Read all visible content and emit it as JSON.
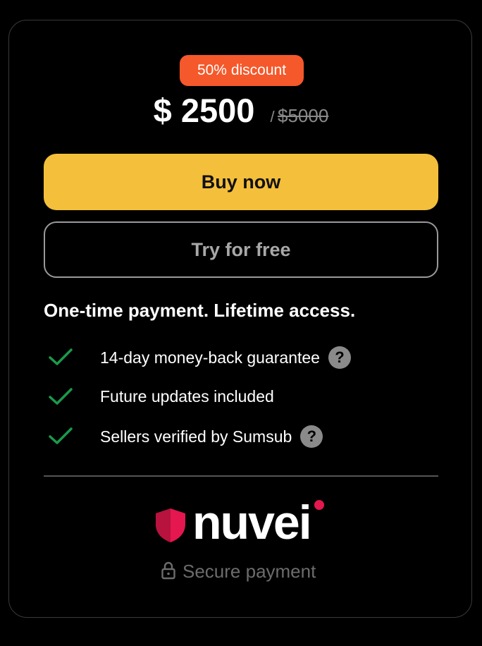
{
  "pricing": {
    "discount_badge": "50% discount",
    "price": "$ 2500",
    "slash": "/",
    "old_price": "$5000"
  },
  "actions": {
    "buy_label": "Buy now",
    "try_label": "Try for free"
  },
  "headline": "One-time payment. Lifetime access.",
  "features": [
    {
      "text": "14-day money-back guarantee",
      "icon": "check-icon",
      "has_help": true
    },
    {
      "text": "Future updates included",
      "icon": "check-icon",
      "has_help": false
    },
    {
      "text": "Sellers verified by Sumsub",
      "icon": "check-icon",
      "has_help": true
    }
  ],
  "help_glyph": "?",
  "footer": {
    "brand": "nuvei",
    "secure_label": "Secure payment"
  },
  "colors": {
    "discount": "#f5582a",
    "buy_button": "#f4bf3b",
    "check": "#1a9a4a",
    "brand": "#e5174f"
  }
}
